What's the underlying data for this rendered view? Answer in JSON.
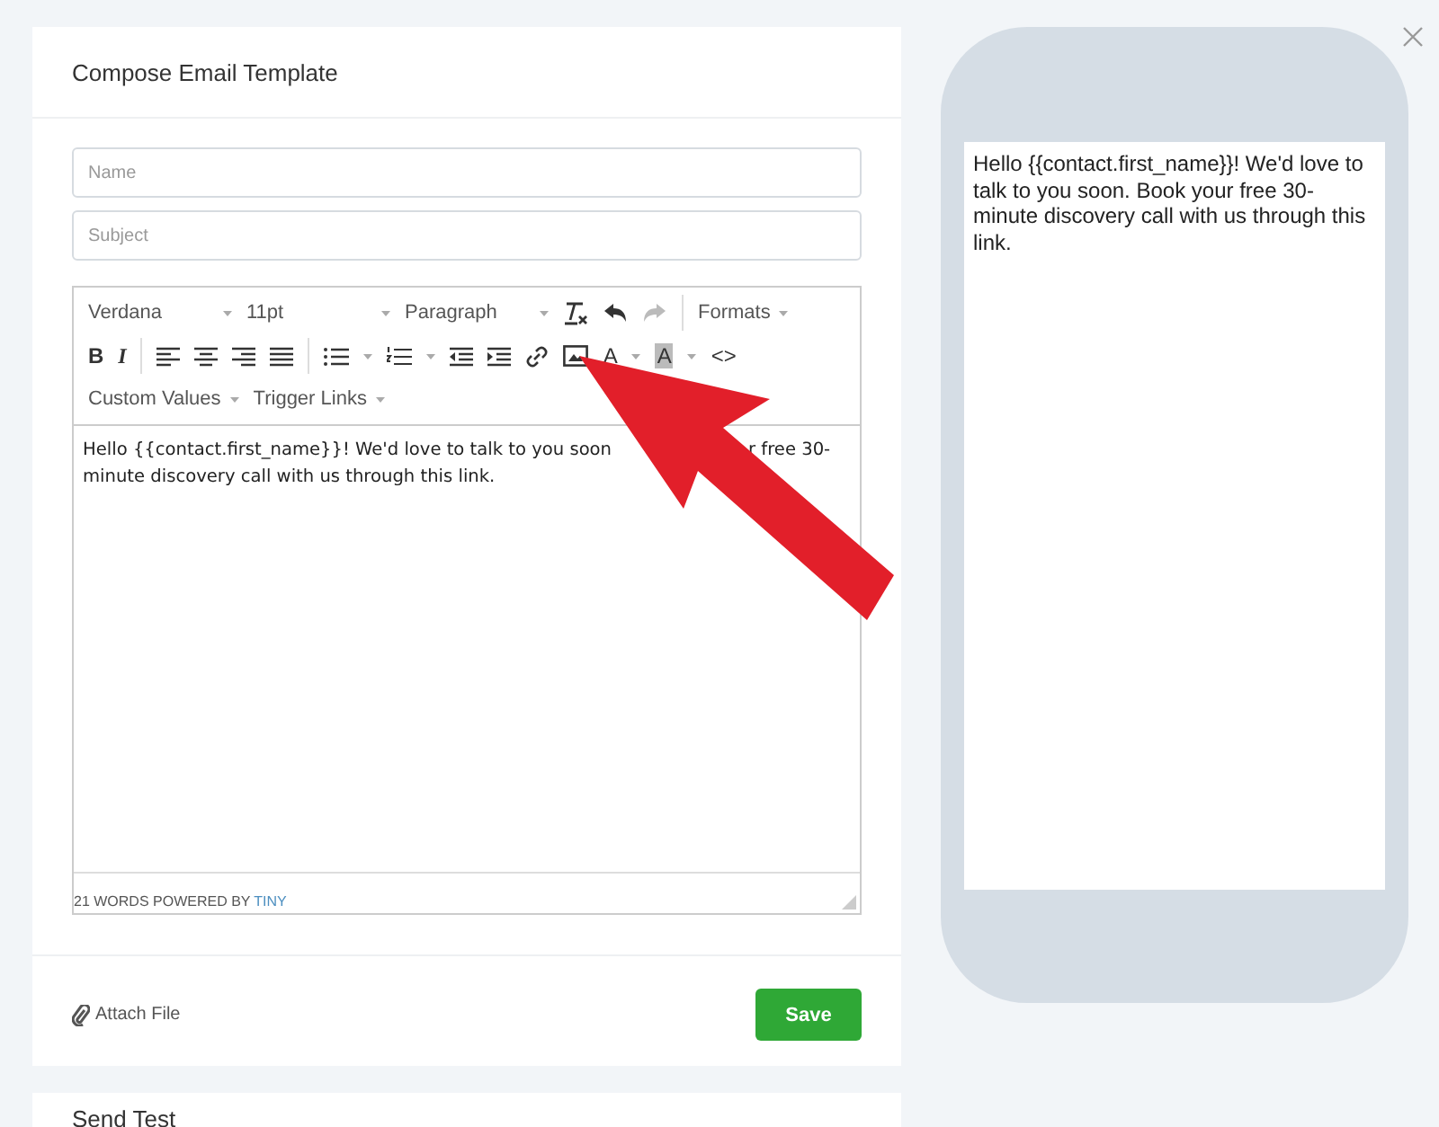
{
  "card_title": "Compose Email Template",
  "name_field": {
    "placeholder": "Name"
  },
  "subject_field": {
    "placeholder": "Subject"
  },
  "toolbar": {
    "font": "Verdana",
    "size": "11pt",
    "block": "Paragraph",
    "formats": "Formats",
    "bold": "B",
    "italic": "I",
    "text_color": "A",
    "background_color": "A",
    "code": "<>",
    "custom_values": "Custom Values",
    "trigger_links": "Trigger Links"
  },
  "editor_text": [
    "Hello {{contact.first_name}}! We'd love to talk to you soon",
    "r free 30-minute discovery call with us through this link."
  ],
  "status": {
    "words": "21 WORDS POWERED BY",
    "brand": "TINY"
  },
  "attach": "Attach File",
  "save": "Save",
  "next_card_title": "Send Test",
  "preview_text": "Hello {{contact.first_name}}! We'd love to talk to you soon. Book your free 30-minute discovery call with us through this link."
}
